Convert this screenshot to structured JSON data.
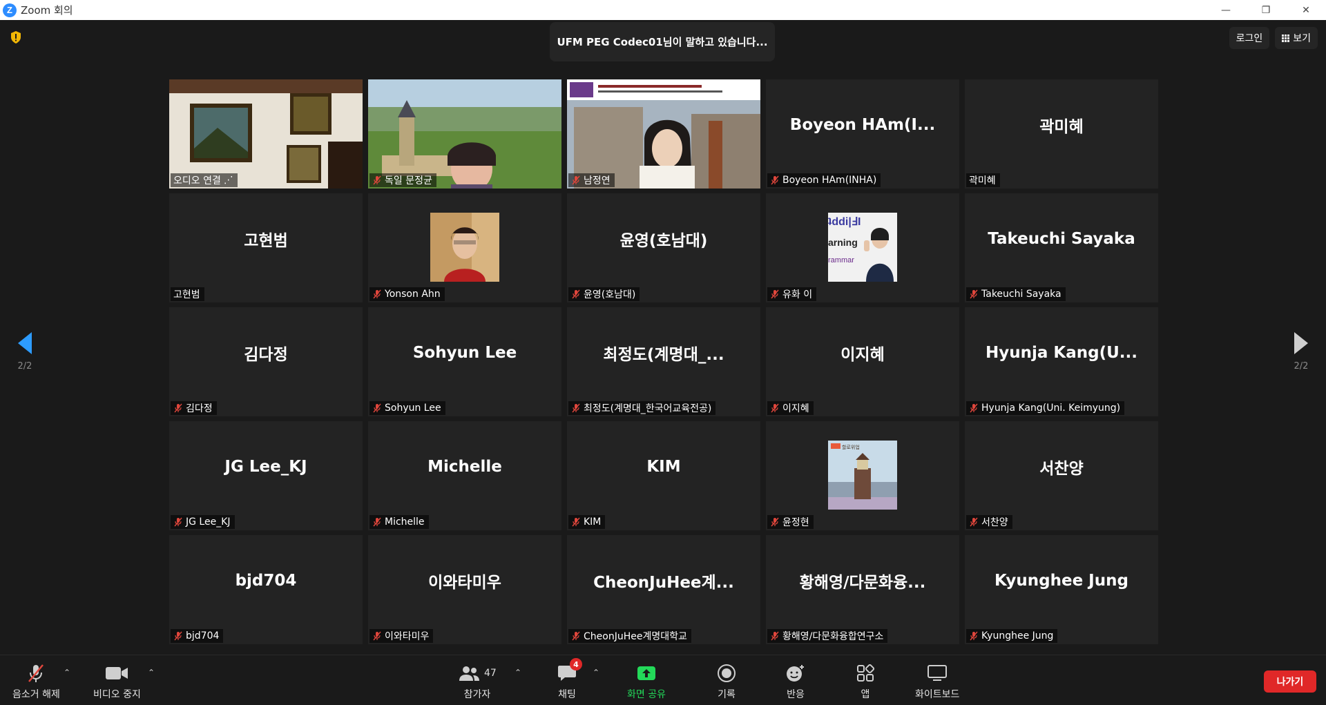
{
  "window": {
    "title": "Zoom 회의",
    "minimize": "—",
    "restore": "❐",
    "close": "✕"
  },
  "meeting": {
    "speaker_banner": "UFM PEG Codec01님이 말하고 있습니다...",
    "login_label": "로그인",
    "view_label": "보기",
    "page_indicator_left": "2/2",
    "page_indicator_right": "2/2"
  },
  "tiles": [
    {
      "display": "",
      "label": "오디오 연결",
      "muted": false,
      "kind": "video-painting"
    },
    {
      "display": "",
      "label": "독일 문정균",
      "muted": true,
      "kind": "video-castle"
    },
    {
      "display": "",
      "label": "남정연",
      "muted": true,
      "kind": "video-conference"
    },
    {
      "display": "Boyeon  HAm(I...",
      "label": "Boyeon HAm(INHA)",
      "muted": true,
      "kind": "name"
    },
    {
      "display": "곽미혜",
      "label": "곽미혜",
      "muted": false,
      "kind": "name"
    },
    {
      "display": "고현범",
      "label": "고현범",
      "muted": false,
      "kind": "name"
    },
    {
      "display": "",
      "label": "Yonson Ahn",
      "muted": true,
      "kind": "photo-woman"
    },
    {
      "display": "윤영(호남대)",
      "label": "윤영(호남대)",
      "muted": true,
      "kind": "name"
    },
    {
      "display": "",
      "label": "유화 이",
      "muted": true,
      "kind": "photo-flipped"
    },
    {
      "display": "Takeuchi Sayaka",
      "label": "Takeuchi Sayaka",
      "muted": true,
      "kind": "name"
    },
    {
      "display": "김다정",
      "label": "김다정",
      "muted": true,
      "kind": "name"
    },
    {
      "display": "Sohyun Lee",
      "label": "Sohyun Lee",
      "muted": true,
      "kind": "name"
    },
    {
      "display": "최정도(계명대_...",
      "label": "최정도(계명대_한국어교육전공)",
      "muted": true,
      "kind": "name"
    },
    {
      "display": "이지혜",
      "label": "이지혜",
      "muted": true,
      "kind": "name"
    },
    {
      "display": "Hyunja  Kang(U...",
      "label": "Hyunja Kang(Uni. Keimyung)",
      "muted": true,
      "kind": "name"
    },
    {
      "display": "JG Lee_KJ",
      "label": "JG Lee_KJ",
      "muted": true,
      "kind": "name"
    },
    {
      "display": "Michelle",
      "label": "Michelle",
      "muted": true,
      "kind": "name"
    },
    {
      "display": "KIM",
      "label": "KIM",
      "muted": true,
      "kind": "name"
    },
    {
      "display": "",
      "label": "윤정현",
      "muted": true,
      "kind": "photo-lighthouse"
    },
    {
      "display": "서찬양",
      "label": "서찬양",
      "muted": true,
      "kind": "name"
    },
    {
      "display": "bjd704",
      "label": "bjd704",
      "muted": true,
      "kind": "name"
    },
    {
      "display": "이와타미우",
      "label": "이와타미우",
      "muted": true,
      "kind": "name"
    },
    {
      "display": "CheonJuHee계...",
      "label": "CheonJuHee계명대학교",
      "muted": true,
      "kind": "name"
    },
    {
      "display": "황해영/다문화융...",
      "label": "황해영/다문화융합연구소",
      "muted": true,
      "kind": "name"
    },
    {
      "display": "Kyunghee Jung",
      "label": "Kyunghee Jung",
      "muted": true,
      "kind": "name"
    }
  ],
  "toolbar": {
    "unmute": "음소거 해제",
    "stop_video": "비디오 중지",
    "participants": "참가자",
    "participants_count": "47",
    "chat": "채팅",
    "chat_badge": "4",
    "share_screen": "화면 공유",
    "record": "기록",
    "reactions": "반응",
    "apps": "앱",
    "whiteboard": "화이트보드",
    "leave": "나가기"
  },
  "colors": {
    "accent": "#2d8cff",
    "share_green": "#23d959",
    "leave_red": "#e02828",
    "mute_red": "#e0463c"
  }
}
